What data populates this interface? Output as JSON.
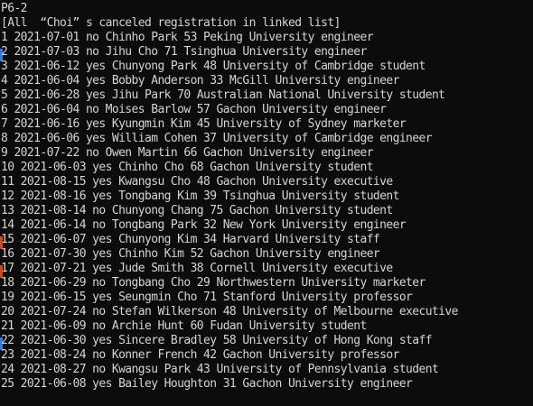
{
  "console": {
    "lines": [
      "P6-2",
      "[All  “Choi” s canceled registration in linked list]",
      "1 2021-07-01 no Chinho Park 53 Peking University engineer",
      "2 2021-07-03 no Jihu Cho 71 Tsinghua University engineer",
      "3 2021-06-12 yes Chunyong Park 48 University of Cambridge student",
      "4 2021-06-04 yes Bobby Anderson 33 McGill University engineer",
      "5 2021-06-28 yes Jihu Park 70 Australian National University student",
      "6 2021-06-04 no Moises Barlow 57 Gachon University engineer",
      "7 2021-06-16 yes Kyungmin Kim 45 University of Sydney marketer",
      "8 2021-06-06 yes William Cohen 37 University of Cambridge engineer",
      "9 2021-07-22 no Owen Martin 66 Gachon University engineer",
      "10 2021-06-03 yes Chinho Cho 68 Gachon University student",
      "11 2021-08-15 yes Kwangsu Cho 48 Gachon University executive",
      "12 2021-08-16 yes Tongbang Kim 39 Tsinghua University student",
      "13 2021-08-14 no Chunyong Chang 75 Gachon University student",
      "14 2021-06-14 no Tongbang Park 32 New York University engineer",
      "15 2021-06-07 yes Chunyong Kim 34 Harvard University staff",
      "16 2021-07-30 yes Chinho Kim 52 Gachon University engineer",
      "17 2021-07-21 yes Jude Smith 38 Cornell University executive",
      "18 2021-06-29 no Tongbang Cho 29 Northwestern University marketer",
      "19 2021-06-15 yes Seungmin Cho 71 Stanford University professor",
      "20 2021-07-24 no Stefan Wilkerson 48 University of Melbourne executive",
      "21 2021-06-09 no Archie Hunt 60 Fudan University student",
      "22 2021-06-30 yes Sincere Bradley 58 University of Hong Kong staff",
      "23 2021-08-24 no Konner French 42 Gachon University professor",
      "24 2021-08-27 no Kwangsu Park 43 University of Pennsylvania student",
      "25 2021-06-08 yes Bailey Houghton 31 Gachon University engineer"
    ]
  },
  "colors": {
    "background": "#0c0c0c",
    "text": "#d4d4d4",
    "edge_marks": [
      "#3a78d6",
      "#c84a2a",
      "#3a78d6",
      "#c84a2a"
    ]
  }
}
